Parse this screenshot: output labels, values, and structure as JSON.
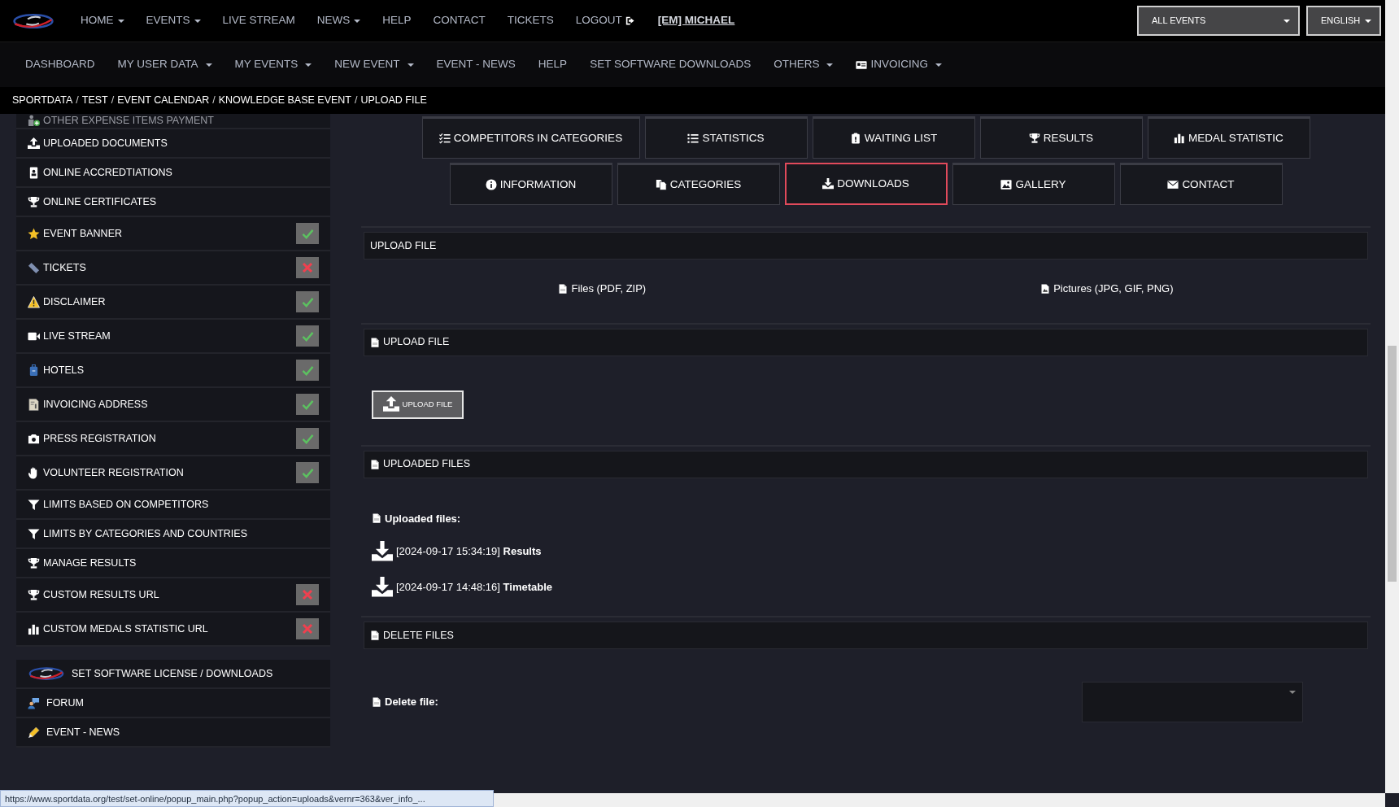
{
  "top_nav": {
    "items": [
      {
        "label": "HOME",
        "dropdown": true
      },
      {
        "label": "EVENTS",
        "dropdown": true
      },
      {
        "label": "LIVE STREAM",
        "dropdown": false
      },
      {
        "label": "NEWS",
        "dropdown": true
      },
      {
        "label": "HELP",
        "dropdown": false
      },
      {
        "label": "CONTACT",
        "dropdown": false
      },
      {
        "label": "TICKETS",
        "dropdown": false
      },
      {
        "label": "LOGOUT",
        "dropdown": false
      }
    ],
    "user": "[EM] MICHAEL",
    "event_select": {
      "value": "ALL EVENTS"
    },
    "language_select": {
      "value": "ENGLISH"
    }
  },
  "sub_nav": {
    "items": [
      {
        "label": "DASHBOARD",
        "dropdown": false
      },
      {
        "label": "MY USER DATA",
        "dropdown": true
      },
      {
        "label": "MY EVENTS",
        "dropdown": true
      },
      {
        "label": "NEW EVENT",
        "dropdown": true
      },
      {
        "label": "EVENT - NEWS",
        "dropdown": false
      },
      {
        "label": "HELP",
        "dropdown": false
      },
      {
        "label": "SET SOFTWARE DOWNLOADS",
        "dropdown": false
      },
      {
        "label": "OTHERS",
        "dropdown": true
      },
      {
        "label": "INVOICING",
        "dropdown": true
      }
    ]
  },
  "breadcrumb": {
    "separator": "/",
    "items": [
      "SPORTDATA",
      "TEST",
      "EVENT CALENDAR",
      "KNOWLEDGE BASE EVENT",
      "UPLOAD FILE"
    ]
  },
  "sidebar": {
    "items": [
      {
        "label": "OTHER EXPENSE ITEMS PAYMENT"
      },
      {
        "label": "UPLOADED DOCUMENTS"
      },
      {
        "label": "ONLINE ACCREDTIATIONS"
      },
      {
        "label": "ONLINE CERTIFICATES"
      },
      {
        "label": "EVENT BANNER",
        "done": true
      },
      {
        "label": "TICKETS",
        "done": false
      },
      {
        "label": "DISCLAIMER",
        "done": true
      },
      {
        "label": "LIVE STREAM",
        "done": true
      },
      {
        "label": "HOTELS",
        "done": true
      },
      {
        "label": "INVOICING ADDRESS",
        "done": true
      },
      {
        "label": "PRESS REGISTRATION",
        "done": true
      },
      {
        "label": "VOLUNTEER REGISTRATION",
        "done": true
      },
      {
        "label": "LIMITS BASED ON COMPETITORS"
      },
      {
        "label": "LIMITS BY CATEGORIES AND COUNTRIES"
      },
      {
        "label": "MANAGE RESULTS"
      },
      {
        "label": "CUSTOM RESULTS URL",
        "done": false
      },
      {
        "label": "CUSTOM MEDALS STATISTIC URL",
        "done": false
      }
    ],
    "extra_items": [
      {
        "label": "SET SOFTWARE LICENSE / DOWNLOADS"
      },
      {
        "label": "FORUM"
      },
      {
        "label": "EVENT - NEWS"
      }
    ]
  },
  "tab_rows": [
    [
      {
        "label": "COMPETITORS IN CATEGORIES",
        "selected": false
      },
      {
        "label": "STATISTICS",
        "selected": false
      },
      {
        "label": "WAITING LIST",
        "selected": false
      },
      {
        "label": "RESULTS",
        "selected": false
      },
      {
        "label": "MEDAL STATISTIC",
        "selected": false
      }
    ],
    [
      {
        "label": "INFORMATION",
        "selected": false
      },
      {
        "label": "CATEGORIES",
        "selected": false
      },
      {
        "label": "DOWNLOADS",
        "selected": true
      },
      {
        "label": "GALLERY",
        "selected": false
      },
      {
        "label": "CONTACT",
        "selected": false
      }
    ]
  ],
  "sections": [
    {
      "kind": "file_types",
      "title": "UPLOAD FILE",
      "links": [
        "Files (PDF, ZIP)",
        "Pictures (JPG, GIF, PNG)"
      ]
    },
    {
      "kind": "upload",
      "title": "UPLOAD FILE",
      "button": "UPLOAD FILE"
    },
    {
      "kind": "file_list",
      "title": "UPLOADED FILES",
      "label": "Uploaded files:",
      "files": [
        {
          "timestamp": "[2024-09-17 15:34:19]",
          "name": "Results"
        },
        {
          "timestamp": "[2024-09-17 14:48:16]",
          "name": "Timetable"
        }
      ]
    },
    {
      "kind": "delete",
      "title": "DELETE FILES",
      "label": "Delete file:"
    }
  ],
  "status_url": "https://www.sportdata.org/test/set-online/popup_main.php?popup_action=uploads&vernr=363&ver_info_..."
}
